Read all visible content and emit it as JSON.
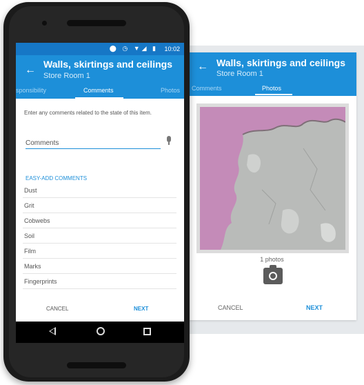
{
  "status_bar": {
    "icons": "⬤ ◷ ▼◢ ▮",
    "time": "10:02"
  },
  "screen1": {
    "title": "Walls, skirtings and ceilings",
    "subtitle": "Store Room 1",
    "tabs": [
      {
        "label": "sponsibility"
      },
      {
        "label": "Comments"
      },
      {
        "label": "Photos"
      }
    ],
    "active_tab": "Comments",
    "instruction": "Enter any comments related to the state of this item.",
    "comments_placeholder": "Comments",
    "easy_add_heading": "EASY-ADD COMMENTS",
    "easy_add_items": [
      "Dust",
      "Grit",
      "Cobwebs",
      "Soil",
      "Film",
      "Marks",
      "Fingerprints"
    ],
    "cancel_label": "CANCEL",
    "next_label": "NEXT"
  },
  "screen2": {
    "title": "Walls, skirtings and ceilings",
    "subtitle": "Store Room 1",
    "tabs": [
      {
        "label": "Comments"
      },
      {
        "label": "Photos"
      }
    ],
    "active_tab": "Photos",
    "photo_count": "1 photos",
    "cancel_label": "CANCEL",
    "next_label": "NEXT"
  },
  "colors": {
    "primary": "#1d8fd9",
    "status_bar": "#1677c6",
    "wall_pink": "#c48bb8",
    "wall_grey": "#b9bbb9"
  },
  "icons": [
    "back-arrow-icon",
    "microphone-icon",
    "camera-icon",
    "nav-back-icon",
    "nav-home-icon",
    "nav-recents-icon"
  ]
}
